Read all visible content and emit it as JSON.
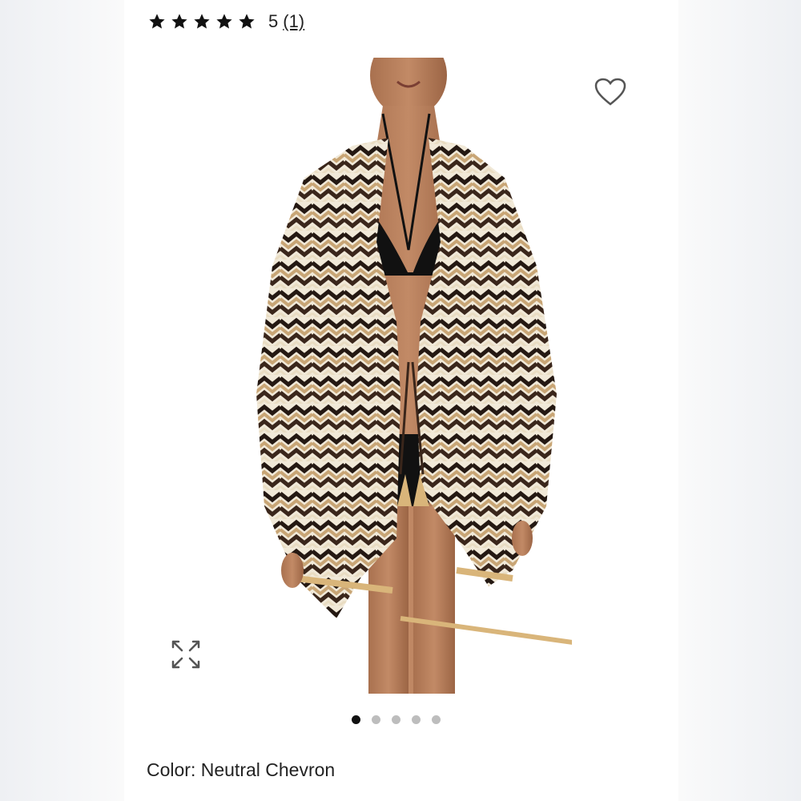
{
  "rating": {
    "stars_filled": 5,
    "stars_total": 5,
    "score_label": "5",
    "count_label": "(1)"
  },
  "product_image": {
    "alt": "Model wearing chevron print cover-up kimono over black bikini"
  },
  "icons": {
    "wishlist": "heart-outline-icon",
    "expand": "expand-arrows-icon",
    "star": "star-icon"
  },
  "carousel": {
    "total": 5,
    "active_index": 0
  },
  "color_selection": {
    "text": "Color: Neutral Chevron"
  },
  "colors": {
    "card_bg": "#ffffff",
    "side_bg": "#f2f2f4",
    "text": "#222222",
    "dot_active": "#111111",
    "dot_inactive": "#bdbdbd"
  }
}
